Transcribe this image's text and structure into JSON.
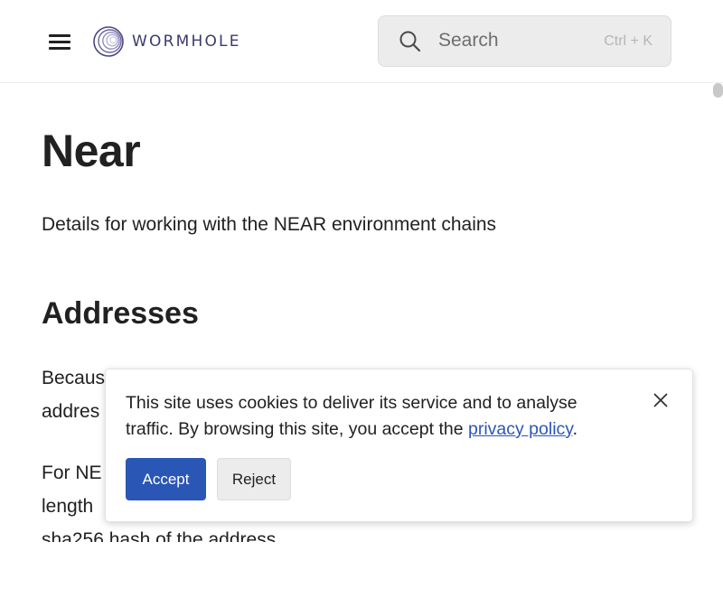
{
  "header": {
    "logo_text": "WORMHOLE",
    "search_placeholder": "Search",
    "search_shortcut": "Ctrl + K"
  },
  "main": {
    "title": "Near",
    "subtitle": "Details for working with the NEAR environment chains",
    "section_heading": "Addresses",
    "paragraph_lines": [
      "Becaus",
      "addres",
      "For NE",
      "length",
      "sha256 hash of the address"
    ]
  },
  "cookie_banner": {
    "text_line1": "This site uses cookies to deliver its service and to analyse",
    "text_line2_prefix": "traffic. By browsing this site, you accept the ",
    "link_text": "privacy policy",
    "text_line2_suffix": ".",
    "accept_label": "Accept",
    "reject_label": "Reject"
  },
  "colors": {
    "accent_blue": "#2a56b6",
    "link_blue": "#2b56b8",
    "logo_text": "#3d3a6e",
    "text": "#212121"
  },
  "icons": [
    "menu-icon",
    "wormhole-logo-icon",
    "search-icon",
    "close-icon"
  ]
}
